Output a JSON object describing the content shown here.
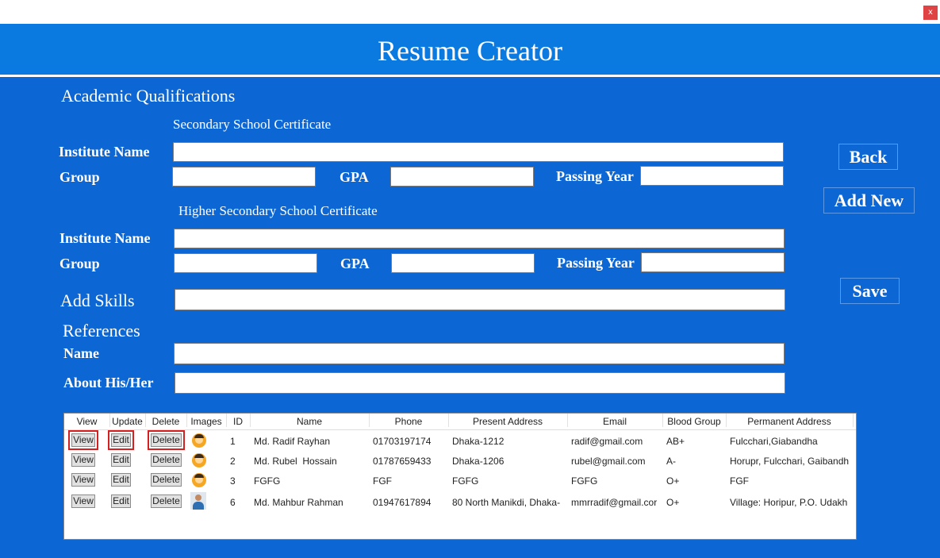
{
  "window": {
    "close_label": "x"
  },
  "app": {
    "title": "Resume Creator"
  },
  "academic": {
    "heading": "Academic Qualifications",
    "ssc": {
      "heading": "Secondary School Certificate",
      "institute_label": "Institute Name",
      "group_label": "Group",
      "gpa_label": "GPA",
      "passing_year_label": "Passing Year",
      "institute_value": "",
      "group_value": "",
      "gpa_value": "",
      "passing_year_value": ""
    },
    "hsc": {
      "heading": "Higher Secondary School Certificate",
      "institute_label": "Institute Name",
      "group_label": "Group",
      "gpa_label": "GPA",
      "passing_year_label": "Passing Year",
      "institute_value": "",
      "group_value": "",
      "gpa_value": "",
      "passing_year_value": ""
    }
  },
  "skills": {
    "label": "Add Skills",
    "value": ""
  },
  "references": {
    "heading": "References",
    "name_label": "Name",
    "about_label": "About His/Her",
    "name_value": "",
    "about_value": ""
  },
  "buttons": {
    "back": "Back",
    "add_new": "Add New",
    "save": "Save"
  },
  "grid": {
    "headers": [
      "View",
      "Update",
      "Delete",
      "Images",
      "ID",
      "Name",
      "Phone",
      "Present Address",
      "Email",
      "Blood Group",
      "Permanent Address"
    ],
    "row_buttons": {
      "view": "View",
      "edit": "Edit",
      "delete": "Delete"
    },
    "rows": [
      {
        "image": "avatar-cartoon",
        "id": "1",
        "name": "Md. Radif Rayhan",
        "phone": "01703197174",
        "present_address": "Dhaka-1212",
        "email": "radif@gmail.com",
        "blood_group": "AB+",
        "permanent_address": "Fulcchari,Giabandha"
      },
      {
        "image": "avatar-cartoon",
        "id": "2",
        "name": "Md. Rubel  Hossain",
        "phone": "01787659433",
        "present_address": "Dhaka-1206",
        "email": "rubel@gmail.com",
        "blood_group": "A-",
        "permanent_address": "Horupr, Fulcchari, Gaibandh"
      },
      {
        "image": "avatar-cartoon",
        "id": "3",
        "name": "FGFG",
        "phone": "FGF",
        "present_address": "FGFG",
        "email": "FGFG",
        "blood_group": "O+",
        "permanent_address": "FGF"
      },
      {
        "image": "avatar-photo",
        "id": "6",
        "name": "Md. Mahbur Rahman",
        "phone": "01947617894",
        "present_address": "80 North Manikdi, Dhaka-",
        "email": "mmrradif@gmail.cor",
        "blood_group": "O+",
        "permanent_address": "Village: Horipur, P.O. Udakh"
      }
    ]
  },
  "colors": {
    "header": "#0a7ae0",
    "panel": "#0c67d4",
    "selection_outline": "#d42020"
  }
}
